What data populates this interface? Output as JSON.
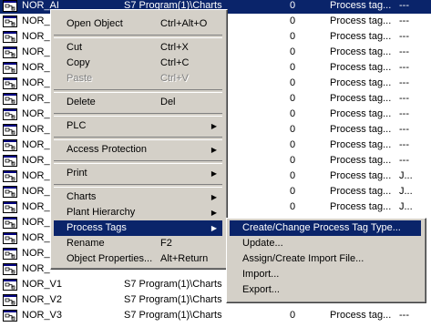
{
  "rows": [
    {
      "name": "NOR_AI",
      "path": "S7 Program(1)\\Charts",
      "size": "0",
      "type": "Process tag...",
      "extra": "---",
      "selected": true
    },
    {
      "name": "NOR_",
      "path": "",
      "size": "0",
      "type": "Process tag...",
      "extra": "---"
    },
    {
      "name": "NOR_",
      "path": "",
      "size": "0",
      "type": "Process tag...",
      "extra": "---"
    },
    {
      "name": "NOR_",
      "path": "",
      "size": "0",
      "type": "Process tag...",
      "extra": "---"
    },
    {
      "name": "NOR_",
      "path": "",
      "size": "0",
      "type": "Process tag...",
      "extra": "---"
    },
    {
      "name": "NOR_",
      "path": "",
      "size": "0",
      "type": "Process tag...",
      "extra": "---"
    },
    {
      "name": "NOR_",
      "path": "",
      "size": "0",
      "type": "Process tag...",
      "extra": "---"
    },
    {
      "name": "NOR_",
      "path": "",
      "size": "0",
      "type": "Process tag...",
      "extra": "---"
    },
    {
      "name": "NOR_",
      "path": "",
      "size": "0",
      "type": "Process tag...",
      "extra": "---"
    },
    {
      "name": "NOR_",
      "path": "",
      "size": "0",
      "type": "Process tag...",
      "extra": "---"
    },
    {
      "name": "NOR_",
      "path": "",
      "size": "0",
      "type": "Process tag...",
      "extra": "---"
    },
    {
      "name": "NOR_",
      "path": "",
      "size": "0",
      "type": "Process tag...",
      "extra": "J..."
    },
    {
      "name": "NOR_",
      "path": "",
      "size": "0",
      "type": "Process tag...",
      "extra": "J..."
    },
    {
      "name": "NOR_",
      "path": "",
      "size": "0",
      "type": "Process tag...",
      "extra": "J..."
    },
    {
      "name": "NOR_",
      "path": "",
      "size": "",
      "type": "",
      "extra": ""
    },
    {
      "name": "NOR_",
      "path": "",
      "size": "",
      "type": "",
      "extra": ""
    },
    {
      "name": "NOR_",
      "path": "",
      "size": "",
      "type": "",
      "extra": ""
    },
    {
      "name": "NOR_",
      "path": "",
      "size": "",
      "type": "",
      "extra": ""
    },
    {
      "name": "NOR_V1",
      "path": "S7 Program(1)\\Charts",
      "size": "",
      "type": "",
      "extra": ""
    },
    {
      "name": "NOR_V2",
      "path": "S7 Program(1)\\Charts",
      "size": "",
      "type": "",
      "extra": ""
    },
    {
      "name": "NOR_V3",
      "path": "S7 Program(1)\\Charts",
      "size": "0",
      "type": "Process tag...",
      "extra": "---"
    }
  ],
  "context_menu": {
    "items": [
      {
        "label": "Open Object",
        "shortcut": "Ctrl+Alt+O"
      },
      {
        "sep": true
      },
      {
        "label": "Cut",
        "shortcut": "Ctrl+X"
      },
      {
        "label": "Copy",
        "shortcut": "Ctrl+C"
      },
      {
        "label": "Paste",
        "shortcut": "Ctrl+V",
        "disabled": true
      },
      {
        "sep": true
      },
      {
        "label": "Delete",
        "shortcut": "Del"
      },
      {
        "sep": true
      },
      {
        "label": "PLC",
        "submenu": true
      },
      {
        "sep": true
      },
      {
        "label": "Access Protection",
        "submenu": true
      },
      {
        "sep": true
      },
      {
        "label": "Print",
        "submenu": true
      },
      {
        "sep": true
      },
      {
        "label": "Charts",
        "submenu": true
      },
      {
        "label": "Plant Hierarchy",
        "submenu": true
      },
      {
        "label": "Process Tags",
        "submenu": true,
        "highlighted": true
      },
      {
        "label": "Rename",
        "shortcut": "F2"
      },
      {
        "label": "Object Properties...",
        "shortcut": "Alt+Return"
      }
    ]
  },
  "submenu": {
    "items": [
      {
        "label": "Create/Change Process Tag Type...",
        "highlighted": true
      },
      {
        "label": "Update..."
      },
      {
        "label": "Assign/Create Import File..."
      },
      {
        "label": "Import..."
      },
      {
        "label": "Export..."
      }
    ]
  },
  "colors": {
    "highlight": "#0a246a",
    "menu_bg": "#d4d0c8"
  }
}
